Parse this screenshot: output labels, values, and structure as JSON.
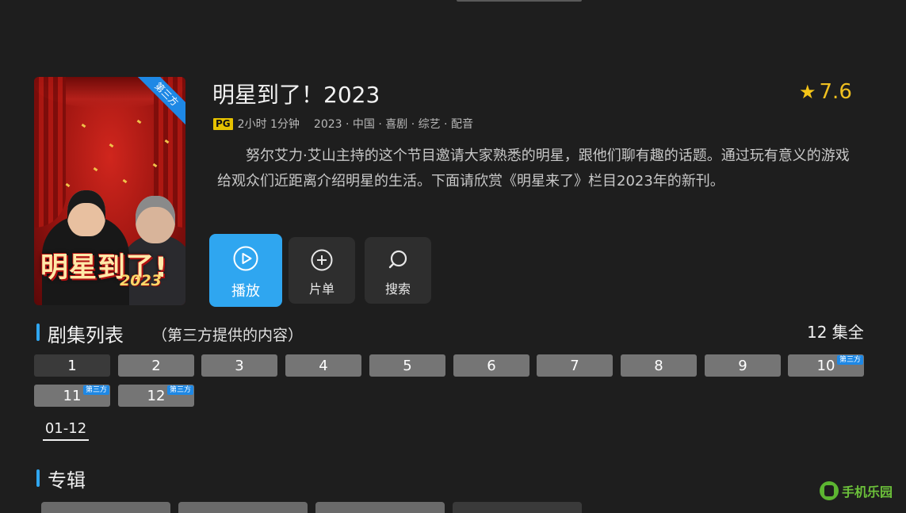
{
  "show": {
    "title": "明星到了！2023",
    "rating": "7.6",
    "pg_badge": "PG",
    "duration": "2小时 1分钟",
    "info": "2023 · 中国 · 喜剧 · 综艺 · 配音",
    "description": "努尔艾力·艾山主持的这个节目邀请大家熟悉的明星，跟他们聊有趣的话题。通过玩有意义的游戏给观众们近距离介绍明星的生活。下面请欣赏《明星来了》栏目2023年的新刊。"
  },
  "poster": {
    "ribbon": "第三方",
    "title_art": "明星到了!",
    "year_art": "2023"
  },
  "actions": [
    {
      "label": "播放",
      "icon": "play-icon"
    },
    {
      "label": "片单",
      "icon": "plus-circle-icon"
    },
    {
      "label": "搜索",
      "icon": "search-icon"
    }
  ],
  "episodes_section": {
    "title": "剧集列表",
    "note": "（第三方提供的内容）",
    "count": "12 集全",
    "range_tab": "01-12",
    "episodes": [
      {
        "num": "1",
        "tag": ""
      },
      {
        "num": "2",
        "tag": ""
      },
      {
        "num": "3",
        "tag": ""
      },
      {
        "num": "4",
        "tag": ""
      },
      {
        "num": "5",
        "tag": ""
      },
      {
        "num": "6",
        "tag": ""
      },
      {
        "num": "7",
        "tag": ""
      },
      {
        "num": "8",
        "tag": ""
      },
      {
        "num": "9",
        "tag": ""
      },
      {
        "num": "10",
        "tag": "第三方"
      },
      {
        "num": "11",
        "tag": "第三方"
      },
      {
        "num": "12",
        "tag": "第三方"
      }
    ]
  },
  "album_section": {
    "title": "专辑"
  },
  "watermark": {
    "text": "手机乐园"
  },
  "colors": {
    "accent": "#2fa6f0",
    "rating": "#f0c020",
    "tag": "#1e88e5",
    "background": "#1e1e1e"
  }
}
